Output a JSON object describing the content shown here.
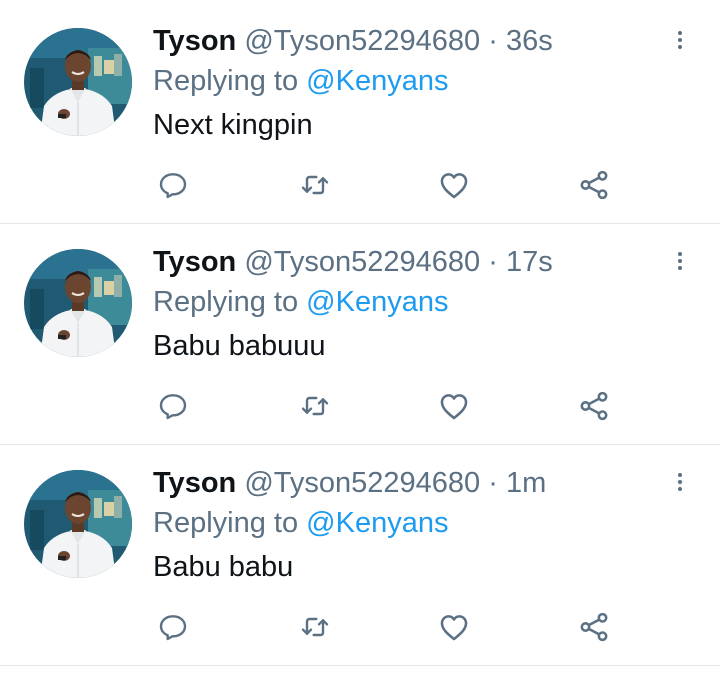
{
  "colors": {
    "text_primary": "#0f1419",
    "text_secondary": "#5b7083",
    "link": "#1d9bf0",
    "divider": "#e1e6ea"
  },
  "icons": {
    "more": "more-vertical-icon",
    "reply": "reply-bubble-icon",
    "retweet": "retweet-icon",
    "like": "heart-icon",
    "share": "share-icon"
  },
  "tweets": [
    {
      "name": "Tyson",
      "handle": "@Tyson52294680",
      "separator": "·",
      "time": "36s",
      "replying_prefix": "Replying to",
      "replying_to": "@Kenyans",
      "text": "Next kingpin"
    },
    {
      "name": "Tyson",
      "handle": "@Tyson52294680",
      "separator": "·",
      "time": "17s",
      "replying_prefix": "Replying to",
      "replying_to": "@Kenyans",
      "text": "Babu babuuu"
    },
    {
      "name": "Tyson",
      "handle": "@Tyson52294680",
      "separator": "·",
      "time": "1m",
      "replying_prefix": "Replying to",
      "replying_to": "@Kenyans",
      "text": "Babu babu"
    }
  ]
}
